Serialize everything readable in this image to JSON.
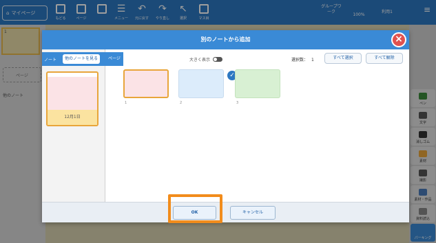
{
  "toolbar": {
    "home_label": "マイページ",
    "items": [
      {
        "label": "もどる"
      },
      {
        "label": "ページ"
      },
      {
        "label": ""
      },
      {
        "label": "メニュー"
      },
      {
        "label": "元に戻す"
      },
      {
        "label": "やり直し"
      },
      {
        "label": "選択"
      },
      {
        "label": "マス目"
      }
    ],
    "group_work": "グループワーク",
    "zoom": "100%",
    "user": "利用1"
  },
  "left_panel": {
    "page_number": "1",
    "add_page": "ページ",
    "other_note": "他のノート"
  },
  "right_tools": [
    {
      "label": "ペン",
      "color": "#3a8a3a"
    },
    {
      "label": "文字",
      "color": "#555555"
    },
    {
      "label": "消しゴム",
      "color": "#333333"
    },
    {
      "label": "素材",
      "color": "#e8a53a"
    },
    {
      "label": "撮影",
      "color": "#555555"
    },
    {
      "label": "素材・作品",
      "color": "#4a7ab8"
    },
    {
      "label": "資料読込",
      "color": "#888888"
    },
    {
      "label": "パーキング",
      "color": "#3a8ad6"
    }
  ],
  "dialog": {
    "title": "別のノートから追加",
    "note_label": "ノート",
    "other_note_button": "他のノートを見る",
    "note_date": "12月1日",
    "page_label": "ページ",
    "large_view": "大きく表示",
    "selected_count_label": "選択数：",
    "selected_count": "1",
    "select_all": "すべて選択",
    "deselect_all": "すべて解除",
    "pages": [
      {
        "number": "1",
        "color": "#fbe3e6",
        "selected": true
      },
      {
        "number": "2",
        "color": "#dcecfb",
        "selected": false
      },
      {
        "number": "3",
        "color": "#d8f0d3",
        "selected": false
      }
    ],
    "ok": "OK",
    "cancel": "キャンセル"
  },
  "colors": {
    "accent": "#2d78c2",
    "highlight": "#f28c1b",
    "close": "#e0524f"
  }
}
